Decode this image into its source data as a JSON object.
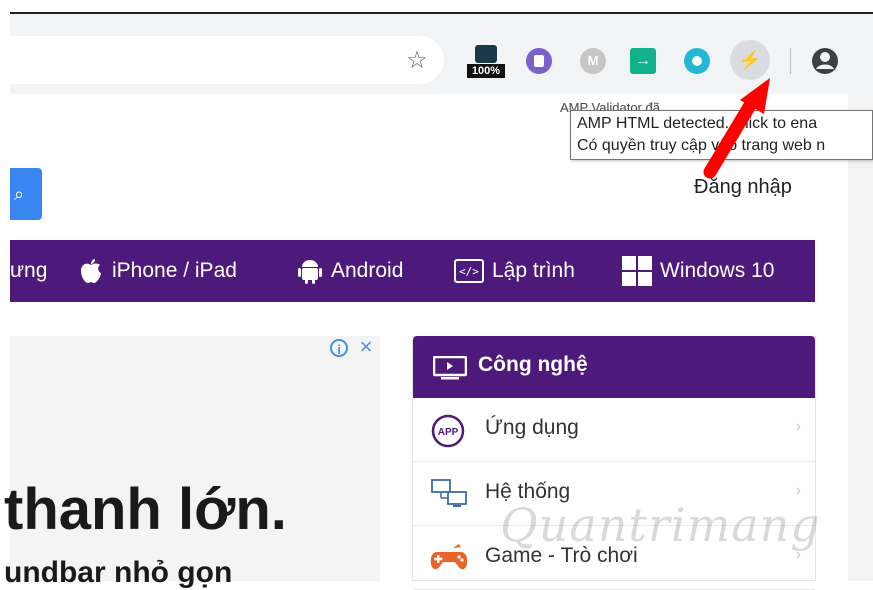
{
  "toolbar": {
    "bookmark_icon": "star-icon",
    "extension_zoom_label": "100%",
    "extension_gray_letter": "M",
    "extension_green_symbol": "→",
    "amp_icon": "lightning-icon",
    "amp_symbol": "⚡",
    "profile_icon": "account-circle-icon"
  },
  "tooltip": {
    "partial_hint": "AMP Validator đã ..",
    "line1": "AMP HTML detected. Click to ena",
    "line2": "Có quyền truy cập vào trang web n"
  },
  "header": {
    "login": "Đăng nhập"
  },
  "nav": {
    "items": [
      {
        "label": "ưng"
      },
      {
        "label": "iPhone / iPad",
        "icon": "apple-icon"
      },
      {
        "label": "Android",
        "icon": "android-icon"
      },
      {
        "label": "Lập trình",
        "icon": "code-icon"
      },
      {
        "label": "Windows 10",
        "icon": "windows-icon"
      }
    ]
  },
  "ad": {
    "headline": "thanh lớn.",
    "sub": "undbar nhỏ gọn"
  },
  "categories": {
    "title": "Công nghệ",
    "items": [
      {
        "label": "Ứng dụng",
        "icon": "app-icon"
      },
      {
        "label": "Hệ thống",
        "icon": "system-icon"
      },
      {
        "label": "Game - Trò chơi",
        "icon": "gamepad-icon"
      }
    ]
  },
  "watermark": "Quantrimang",
  "colors": {
    "nav_purple": "#4d1a7b",
    "accent_blue": "#3a86f0",
    "arrow_red": "#ff0000"
  }
}
